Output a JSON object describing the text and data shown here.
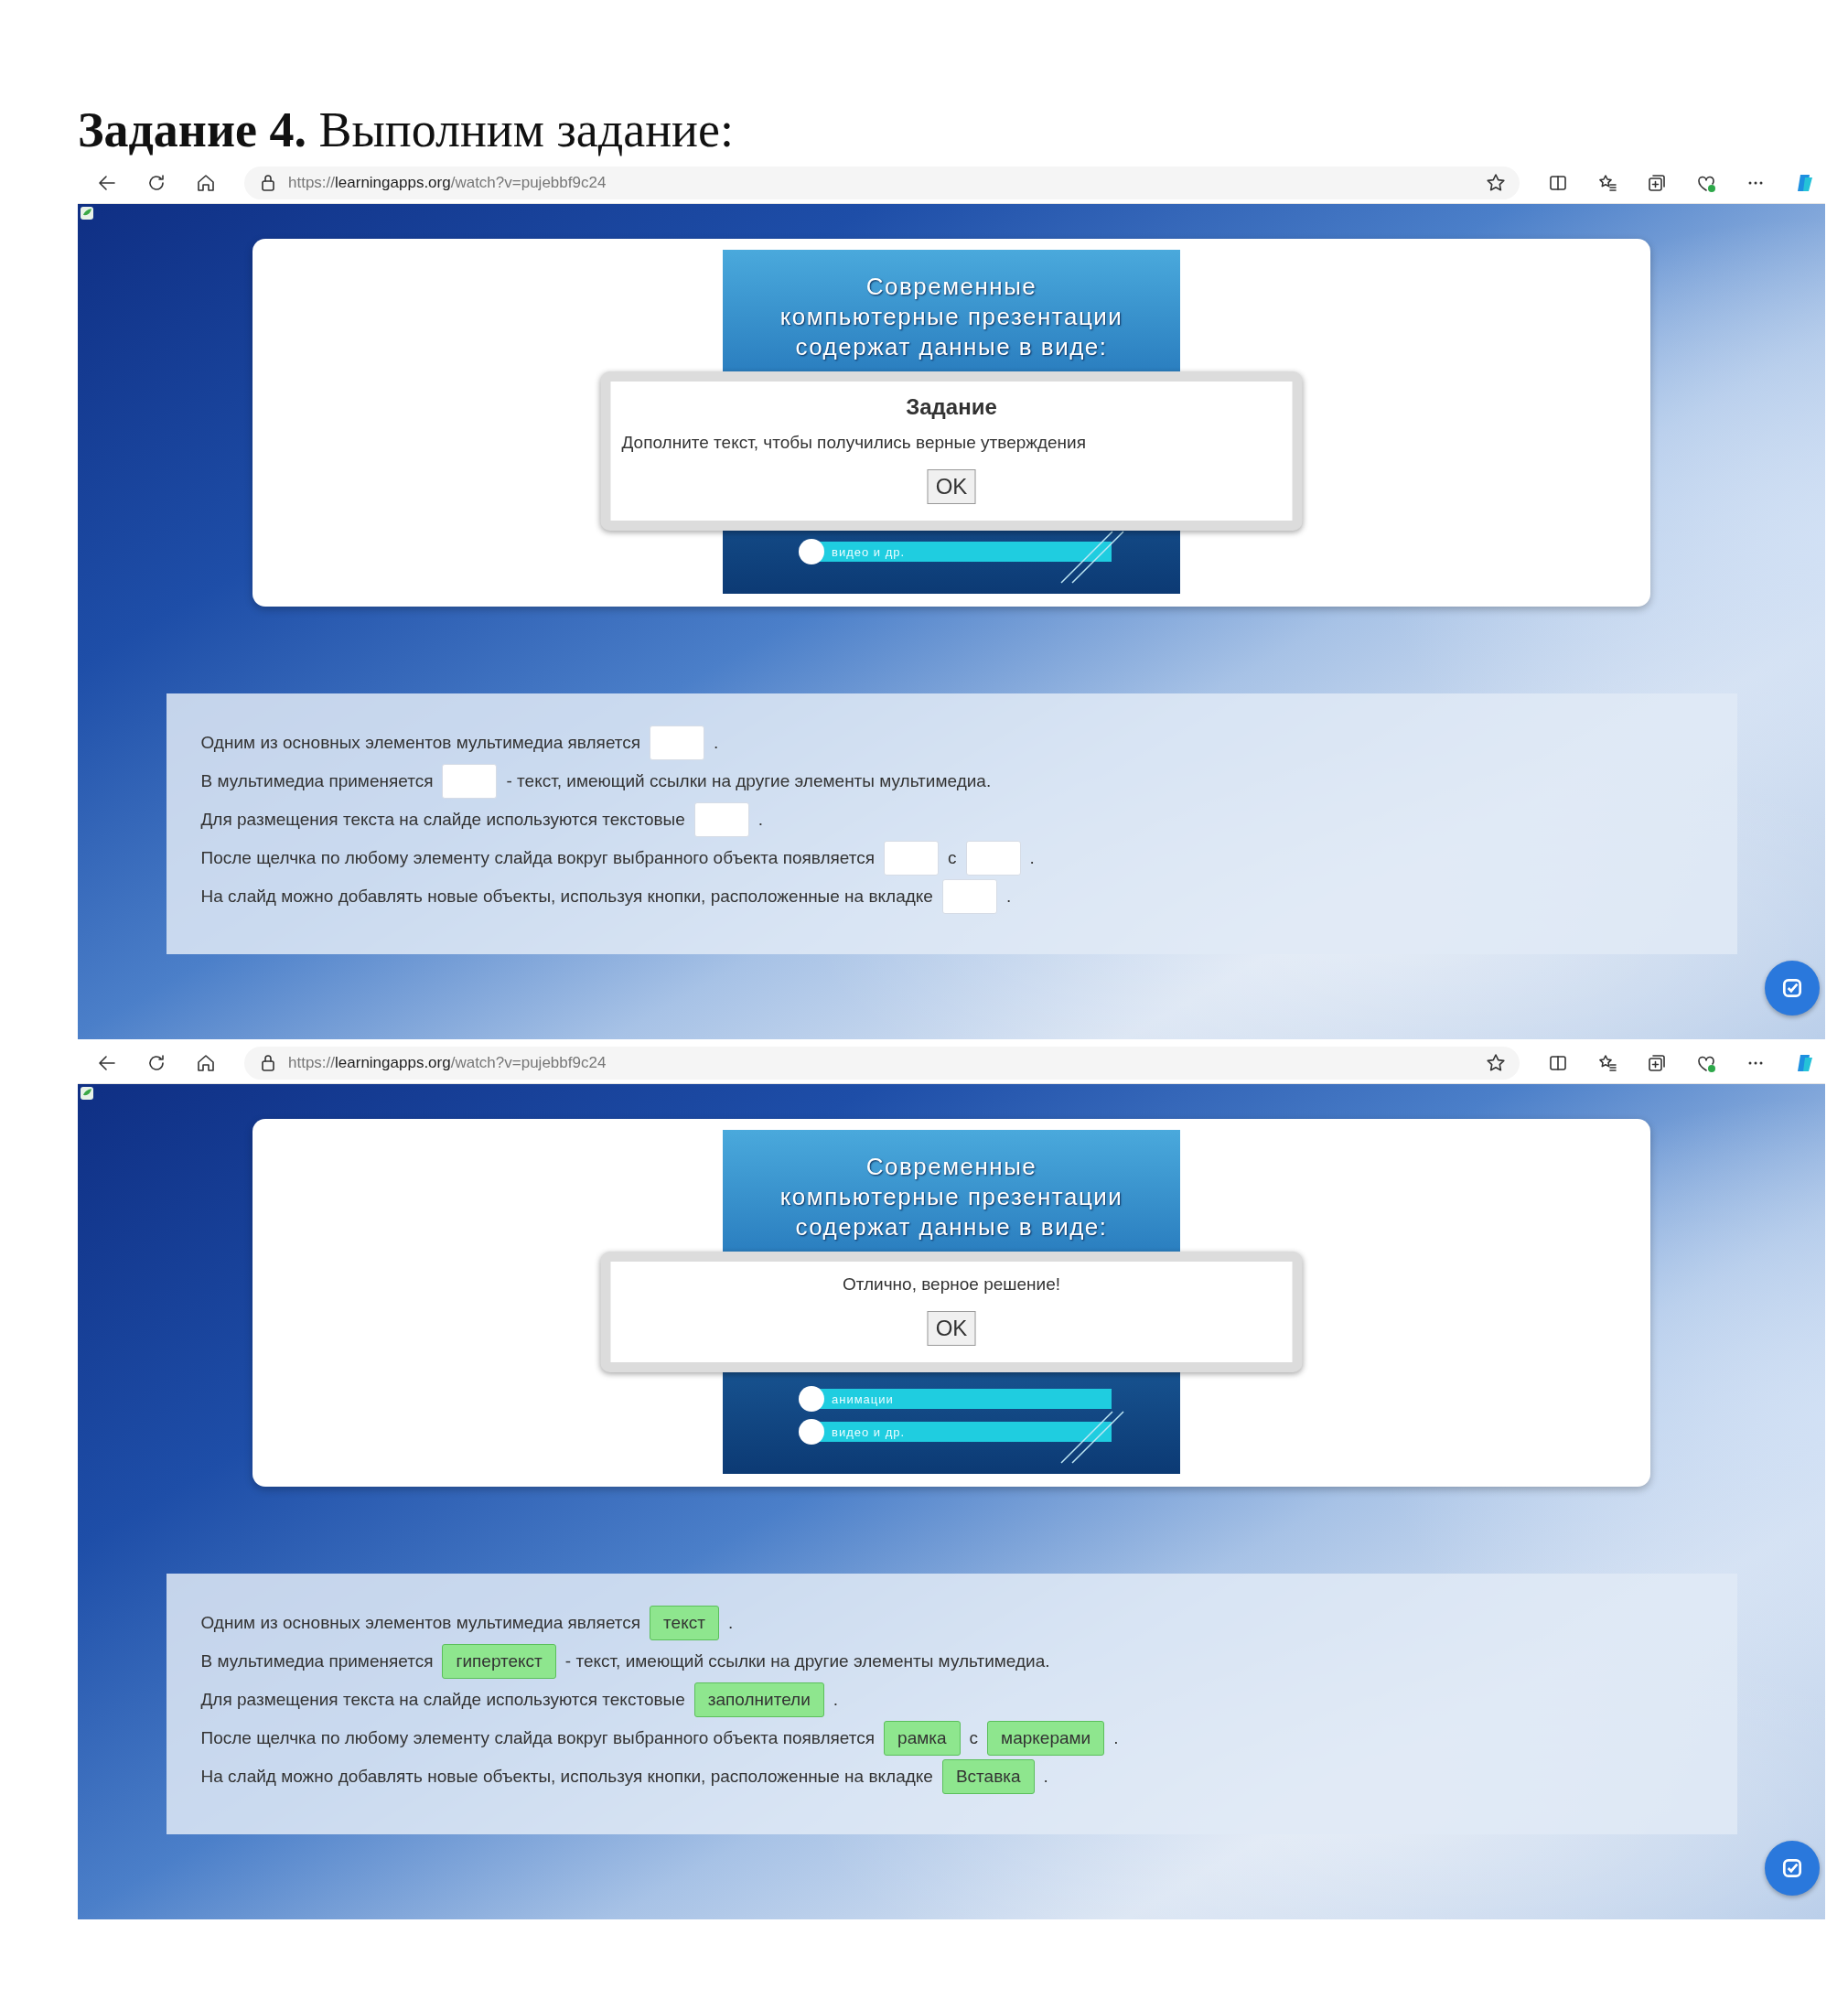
{
  "heading": {
    "label": "Задание 4.",
    "text": "Выполним задание:"
  },
  "windows": [
    {
      "toolbar": {
        "url": {
          "scheme": "https://",
          "host": "learningapps.org",
          "path": "/watch?v=pujebbf9c24"
        }
      },
      "slide": {
        "title": "Современные компьютерные презентации содержат данные в виде:",
        "items": [
          "видео и др."
        ]
      },
      "dialog": {
        "title": "Задание",
        "message": "Дополните текст, чтобы получились верные утверждения",
        "button": "OK"
      },
      "sentences": [
        {
          "parts": [
            {
              "kind": "text",
              "text": "Одним из основных элементов мультимедиа является"
            },
            {
              "kind": "blank"
            },
            {
              "kind": "text",
              "text": "."
            }
          ]
        },
        {
          "parts": [
            {
              "kind": "text",
              "text": "В мультимедиа применяется"
            },
            {
              "kind": "blank"
            },
            {
              "kind": "text",
              "text": "- текст, имеющий ссылки на другие элементы мультимедиа."
            }
          ]
        },
        {
          "parts": [
            {
              "kind": "text",
              "text": "Для размещения текста на слайде используются текстовые"
            },
            {
              "kind": "blank"
            },
            {
              "kind": "text",
              "text": "."
            }
          ]
        },
        {
          "parts": [
            {
              "kind": "text",
              "text": "После щелчка по любому элементу слайда вокруг выбранного объекта появляется"
            },
            {
              "kind": "blank"
            },
            {
              "kind": "text",
              "text": "с"
            },
            {
              "kind": "blank"
            },
            {
              "kind": "text",
              "text": "."
            }
          ]
        },
        {
          "parts": [
            {
              "kind": "text",
              "text": "На слайд можно добавлять новые объекты, используя кнопки, расположенные на вкладке"
            },
            {
              "kind": "blank"
            },
            {
              "kind": "text",
              "text": "."
            }
          ]
        }
      ]
    },
    {
      "toolbar": {
        "url": {
          "scheme": "https://",
          "host": "learningapps.org",
          "path": "/watch?v=pujebbf9c24"
        }
      },
      "slide": {
        "title": "Современные компьютерные презентации содержат данные в виде:",
        "items": [
          "анимации",
          "видео и др."
        ]
      },
      "dialog": {
        "message": "Отлично, верное решение!",
        "button": "OK"
      },
      "sentences": [
        {
          "parts": [
            {
              "kind": "text",
              "text": "Одним из основных элементов мультимедиа является"
            },
            {
              "kind": "blank",
              "correct": true,
              "value": "текст"
            },
            {
              "kind": "text",
              "text": "."
            }
          ]
        },
        {
          "parts": [
            {
              "kind": "text",
              "text": "В мультимедиа применяется"
            },
            {
              "kind": "blank",
              "correct": true,
              "value": "гипертекст"
            },
            {
              "kind": "text",
              "text": "- текст, имеющий ссылки на другие элементы мультимедиа."
            }
          ]
        },
        {
          "parts": [
            {
              "kind": "text",
              "text": "Для размещения текста на слайде используются текстовые"
            },
            {
              "kind": "blank",
              "correct": true,
              "value": "заполнители"
            },
            {
              "kind": "text",
              "text": "."
            }
          ]
        },
        {
          "parts": [
            {
              "kind": "text",
              "text": "После щелчка по любому элементу слайда вокруг выбранного объекта появляется"
            },
            {
              "kind": "blank",
              "correct": true,
              "value": "рамка"
            },
            {
              "kind": "text",
              "text": "с"
            },
            {
              "kind": "blank",
              "correct": true,
              "value": "маркерами"
            },
            {
              "kind": "text",
              "text": "."
            }
          ]
        },
        {
          "parts": [
            {
              "kind": "text",
              "text": "На слайд можно добавлять новые объекты, используя кнопки, расположенные на вкладке"
            },
            {
              "kind": "blank",
              "correct": true,
              "value": "Вставка"
            },
            {
              "kind": "text",
              "text": "."
            }
          ]
        }
      ]
    }
  ]
}
